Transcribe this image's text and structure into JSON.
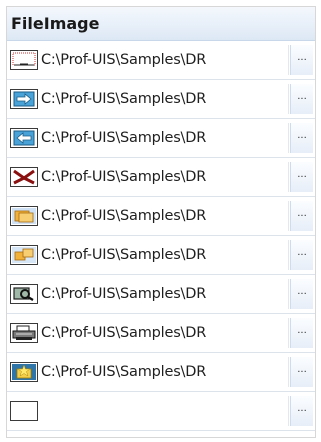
{
  "header": {
    "title": "FileImage"
  },
  "rows": [
    {
      "icon": "dotted-drawing-icon",
      "path": "C:\\Prof-UIS\\Samples\\DR",
      "button": "···"
    },
    {
      "icon": "arrow-right-icon",
      "path": "C:\\Prof-UIS\\Samples\\DR",
      "button": "···"
    },
    {
      "icon": "arrow-left-icon",
      "path": "C:\\Prof-UIS\\Samples\\DR",
      "button": "···"
    },
    {
      "icon": "scissors-icon",
      "path": "C:\\Prof-UIS\\Samples\\DR",
      "button": "···"
    },
    {
      "icon": "folder-open-icon",
      "path": "C:\\Prof-UIS\\Samples\\DR",
      "button": "···"
    },
    {
      "icon": "folder-pair-icon",
      "path": "C:\\Prof-UIS\\Samples\\DR",
      "button": "···"
    },
    {
      "icon": "preview-icon",
      "path": "C:\\Prof-UIS\\Samples\\DR",
      "button": "···"
    },
    {
      "icon": "printer-icon",
      "path": "C:\\Prof-UIS\\Samples\\DR",
      "button": "···"
    },
    {
      "icon": "folder-star-icon",
      "path": "C:\\Prof-UIS\\Samples\\DR",
      "button": "···"
    },
    {
      "icon": "empty-image-icon",
      "path": "",
      "button": "···"
    }
  ]
}
